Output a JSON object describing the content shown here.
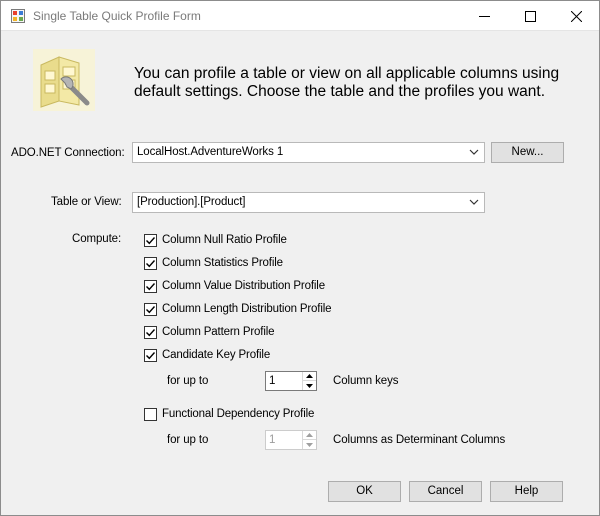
{
  "window": {
    "title": "Single Table Quick Profile Form",
    "controls": {
      "minimize": "—",
      "maximize": "☐",
      "close": "✕"
    }
  },
  "banner": {
    "icon": "data-profile-icon",
    "text": "You can profile a table or view on all applicable columns using default settings. Choose the table and the profiles you want."
  },
  "connection": {
    "label": "ADO.NET Connection:",
    "value": "LocalHost.AdventureWorks 1",
    "new_button": "New..."
  },
  "table": {
    "label": "Table or View:",
    "value": "[Production].[Product]"
  },
  "compute": {
    "label": "Compute:",
    "profiles": [
      {
        "label": "Column Null Ratio Profile",
        "checked": true
      },
      {
        "label": "Column Statistics Profile",
        "checked": true
      },
      {
        "label": "Column Value Distribution Profile",
        "checked": true
      },
      {
        "label": "Column Length Distribution Profile",
        "checked": true
      },
      {
        "label": "Column Pattern Profile",
        "checked": true
      },
      {
        "label": "Candidate Key Profile",
        "checked": true
      }
    ],
    "candidate_key": {
      "for_up_to": "for up to",
      "value": "1",
      "suffix": "Column keys"
    },
    "functional_dependency": {
      "label": "Functional Dependency Profile",
      "checked": false,
      "for_up_to": "for up to",
      "value": "1",
      "suffix": "Columns as Determinant Columns"
    }
  },
  "buttons": {
    "ok": "OK",
    "cancel": "Cancel",
    "help": "Help"
  },
  "colors": {
    "window_bg": "#f0f0f0",
    "titlebar_bg": "#ffffff",
    "button_bg": "#e1e1e1",
    "disabled_text": "#9c9c9c"
  }
}
